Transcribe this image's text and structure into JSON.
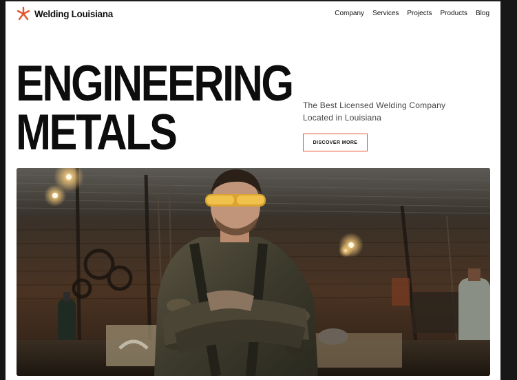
{
  "brand": {
    "name": "Welding Louisiana",
    "logo_icon": "asterisk-star-icon",
    "accent_color": "#e5532d"
  },
  "nav": {
    "items": [
      "Company",
      "Services",
      "Projects",
      "Products",
      "Blog"
    ]
  },
  "hero": {
    "title_lines": [
      "ENGINEERING",
      "METALS"
    ],
    "tagline_lines": [
      "The Best Licensed Welding Company",
      "Located in Louisiana"
    ],
    "cta_label": "DISCOVER MORE",
    "image": "welder-in-workshop-photo"
  }
}
